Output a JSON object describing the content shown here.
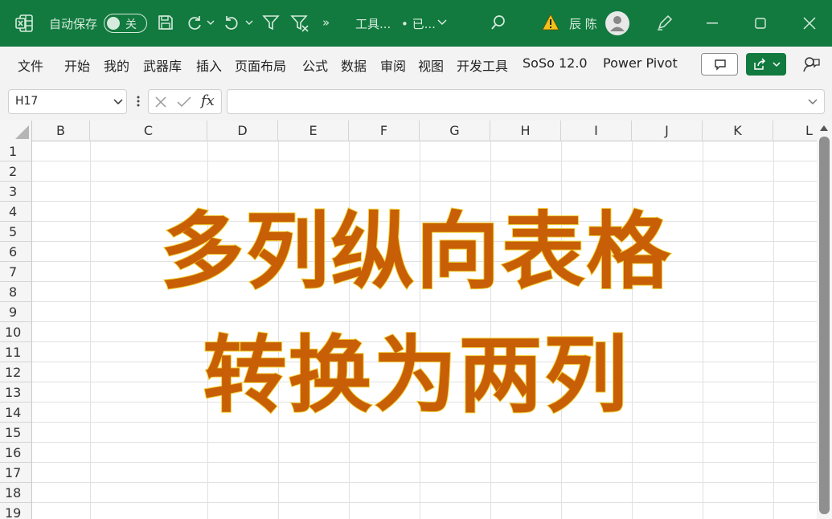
{
  "titlebar": {
    "autosave_label": "自动保存",
    "autosave_state": "关",
    "more_chevron": "»",
    "filename": "工具...",
    "saved_status": "• 已...",
    "user_name": "辰 陈",
    "background_color": "#127a3f"
  },
  "menu": {
    "items": [
      "文件",
      "开始",
      "我的",
      "武器库",
      "插入",
      "页面布局",
      "公式",
      "数据",
      "审阅",
      "视图",
      "开发工具",
      "SoSo 12.0",
      "Power Pivot"
    ]
  },
  "formula_bar": {
    "name_box": "H17",
    "fx_label": "fx",
    "formula_value": ""
  },
  "grid": {
    "columns": [
      "B",
      "C",
      "D",
      "E",
      "F",
      "G",
      "H",
      "I",
      "J",
      "K",
      "L"
    ],
    "rows": [
      "1",
      "2",
      "3",
      "4",
      "5",
      "6",
      "7",
      "8",
      "9",
      "10",
      "11",
      "12",
      "13",
      "14",
      "15",
      "16",
      "17",
      "18",
      "19"
    ]
  },
  "overlay": {
    "line1": "多列纵向表格",
    "line2": "转换为两列",
    "text_color": "#c85f06",
    "outline_color": "#f2d23a"
  }
}
